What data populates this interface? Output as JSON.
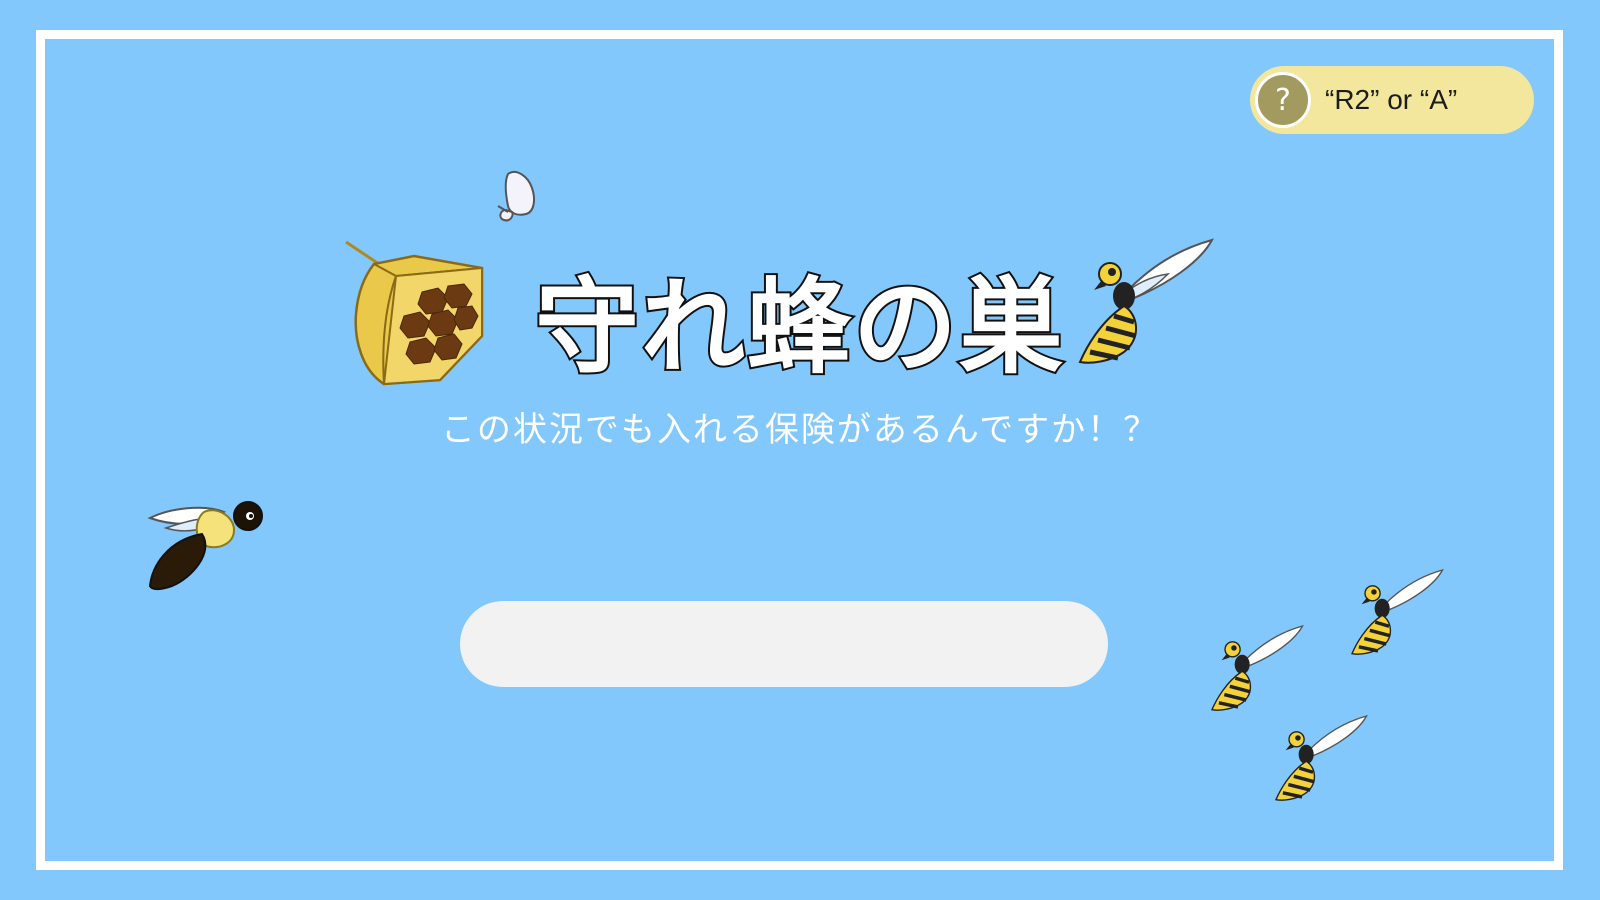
{
  "game": {
    "title": "守れ蜂の巣",
    "subtitle": "この状況でも入れる保険があるんですか！？"
  },
  "help": {
    "icon": "?",
    "hint": "“R2” or “A”"
  },
  "start_button": {
    "label": ""
  },
  "colors": {
    "background": "#82c8fc",
    "frame": "#ffffff",
    "help_pill": "#f2e79c",
    "help_circle": "#a39a5f",
    "start_bar": "#f2f2f2",
    "hive": "#e9c84a",
    "hornet_stripe": "#f4d23a"
  },
  "sprites": [
    "butterfly-icon",
    "beehive-icon",
    "hornet-icon",
    "bumblebee-icon"
  ]
}
